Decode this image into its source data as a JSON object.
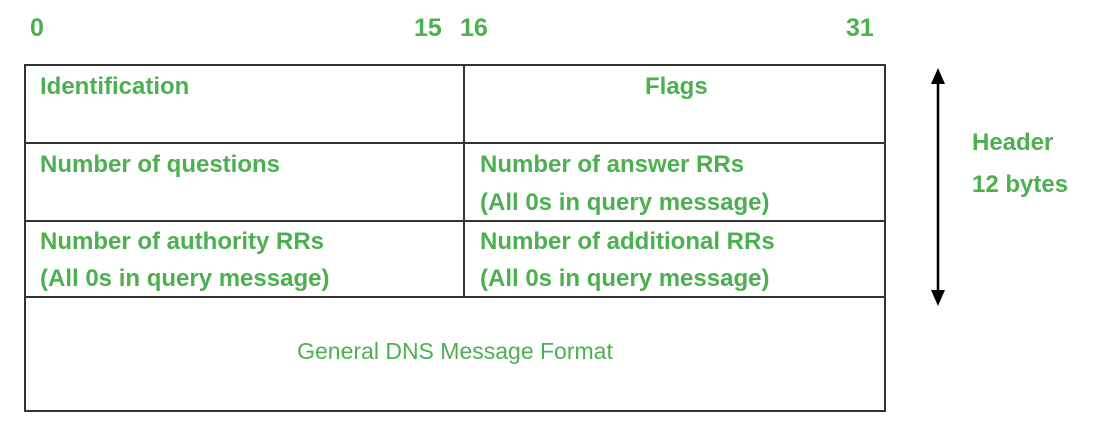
{
  "bit_positions": {
    "start": "0",
    "mid_end": "15",
    "mid_start": "16",
    "end": "31"
  },
  "rows": [
    {
      "left": "Identification",
      "right": "Flags"
    },
    {
      "left": "Number of questions",
      "right_line1": "Number of answer RRs",
      "right_line2": "(All 0s in query message)"
    },
    {
      "left_line1": "Number of authority RRs",
      "left_line2": "(All 0s in query message)",
      "right_line1": "Number of additional RRs",
      "right_line2": "(All 0s in query message)"
    }
  ],
  "footer": "General DNS Message Format",
  "side_label": {
    "line1": "Header",
    "line2": "12 bytes"
  },
  "colors": {
    "text": "#4cb050",
    "border": "#333333",
    "arrow": "#000000"
  }
}
